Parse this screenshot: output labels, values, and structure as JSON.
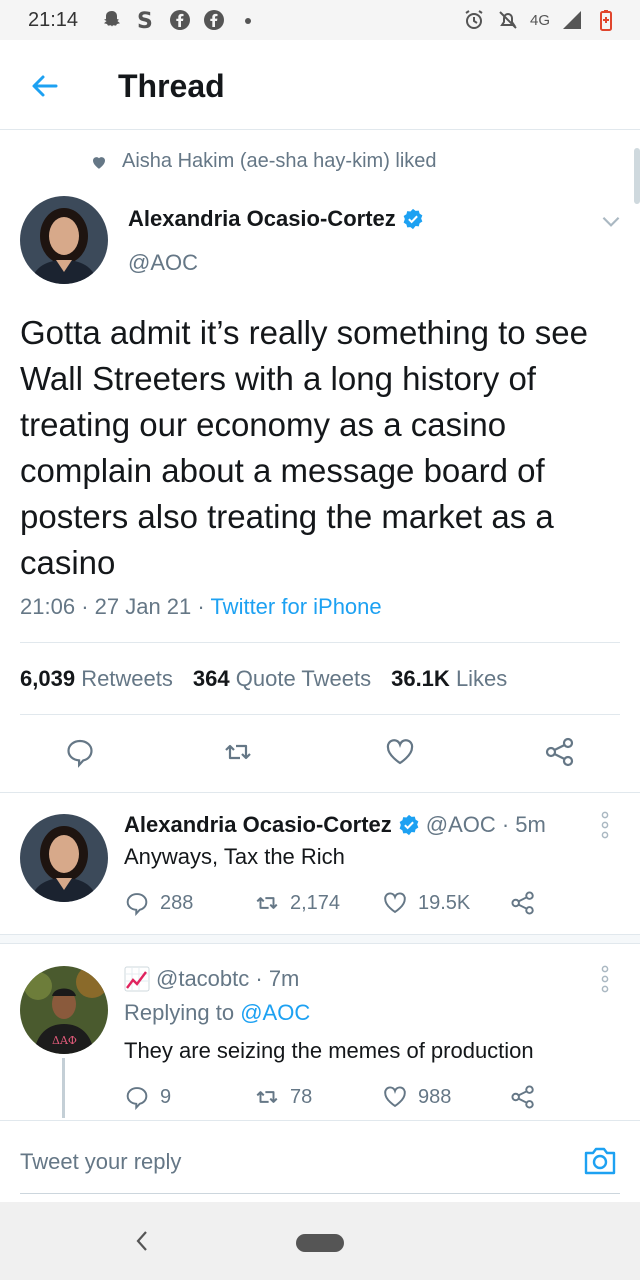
{
  "status_bar": {
    "time": "21:14",
    "network": "4G"
  },
  "header": {
    "title": "Thread"
  },
  "liked_by": "Aisha Hakim (ae-sha hay-kim) liked",
  "main_tweet": {
    "name": "Alexandria Ocasio-Cortez",
    "handle": "@AOC",
    "text": "Gotta admit it’s really something to see Wall Streeters with a long history of treating our economy as a casino complain about a message board of posters also treating the market as a casino",
    "time": "21:06",
    "date": "27 Jan 21",
    "source": "Twitter for iPhone",
    "retweets_count": "6,039",
    "retweets_label": "Retweets",
    "quotes_count": "364",
    "quotes_label": "Quote Tweets",
    "likes_count": "36.1K",
    "likes_label": "Likes"
  },
  "reply_1": {
    "name": "Alexandria Ocasio-Cortez",
    "handle_time": "@AOC · 5m",
    "text": "Anyways, Tax the Rich",
    "replies": "288",
    "retweets": "2,174",
    "likes": "19.5K"
  },
  "reply_2": {
    "handle_time": "@tacobtc · 7m",
    "replying_prefix": "Replying to",
    "replying_to": "@AOC",
    "text": "They are seizing the memes of production",
    "replies": "9",
    "retweets": "78",
    "likes": "988"
  },
  "compose": {
    "placeholder": "Tweet your reply"
  },
  "colors": {
    "accent": "#1da1f2",
    "secondary_text": "#657786",
    "divider": "#e1e8ed"
  }
}
